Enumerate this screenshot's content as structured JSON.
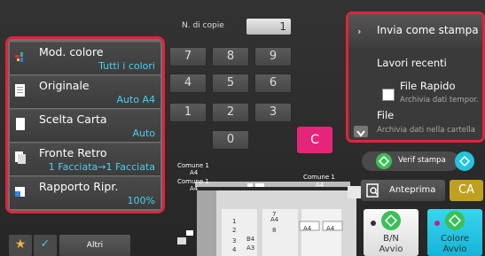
{
  "settings": [
    {
      "label": "Mod. colore",
      "value": "Tutti i colori",
      "icon": "color-mode-icon"
    },
    {
      "label": "Originale",
      "value": "Auto A4",
      "icon": "original-icon"
    },
    {
      "label": "Scelta Carta",
      "value": "Auto",
      "icon": "paper-icon"
    },
    {
      "label": "Fronte Retro",
      "value": "1 Facciata→1 Facciata",
      "icon": "duplex-icon"
    },
    {
      "label": "Rapporto Ripr.",
      "value": "100%",
      "icon": "ratio-icon"
    }
  ],
  "copies": {
    "label": "N. di copie",
    "value": "1"
  },
  "keypad": {
    "keys": [
      "7",
      "8",
      "9",
      "4",
      "5",
      "6",
      "1",
      "2",
      "3",
      "0"
    ],
    "clear": "C"
  },
  "right_panel": {
    "send_label": "Invia come stampa",
    "recent_jobs": "Lavori recenti",
    "quick_file": "File Rapido",
    "quick_file_sub": "Archivia dati tempor.",
    "file": "File",
    "file_sub": "Archivia dati nella cartella"
  },
  "preview_labels": {
    "tray1_l1": "Comune 1",
    "tray1_l2": "A4",
    "tray2_l1": "Comune 1",
    "tray2_l2": "A4",
    "tray3_l1": "Comune 1",
    "tray3_l2": "A4",
    "drawer1": "A4",
    "drawer2": "A4",
    "drawer3": "A4",
    "n1": "1",
    "n2": "2",
    "n3": "3",
    "n4": "4",
    "n7": "7",
    "n8": "8",
    "b4": "B4",
    "a3": "A3"
  },
  "buttons": {
    "verif": "Verif stampa",
    "preview": "Anteprima",
    "ca": "CA",
    "bw_line1": "B/N",
    "bw_line2": "Avvio",
    "color_line1": "Colore",
    "color_line2": "Avvio",
    "altri": "Altri"
  },
  "colors": {
    "highlight": "#e3223c",
    "accent_value": "#49d0f0",
    "clear_key": "#e6257a",
    "color_start": "#14b4d8",
    "ca": "#c0a020"
  }
}
